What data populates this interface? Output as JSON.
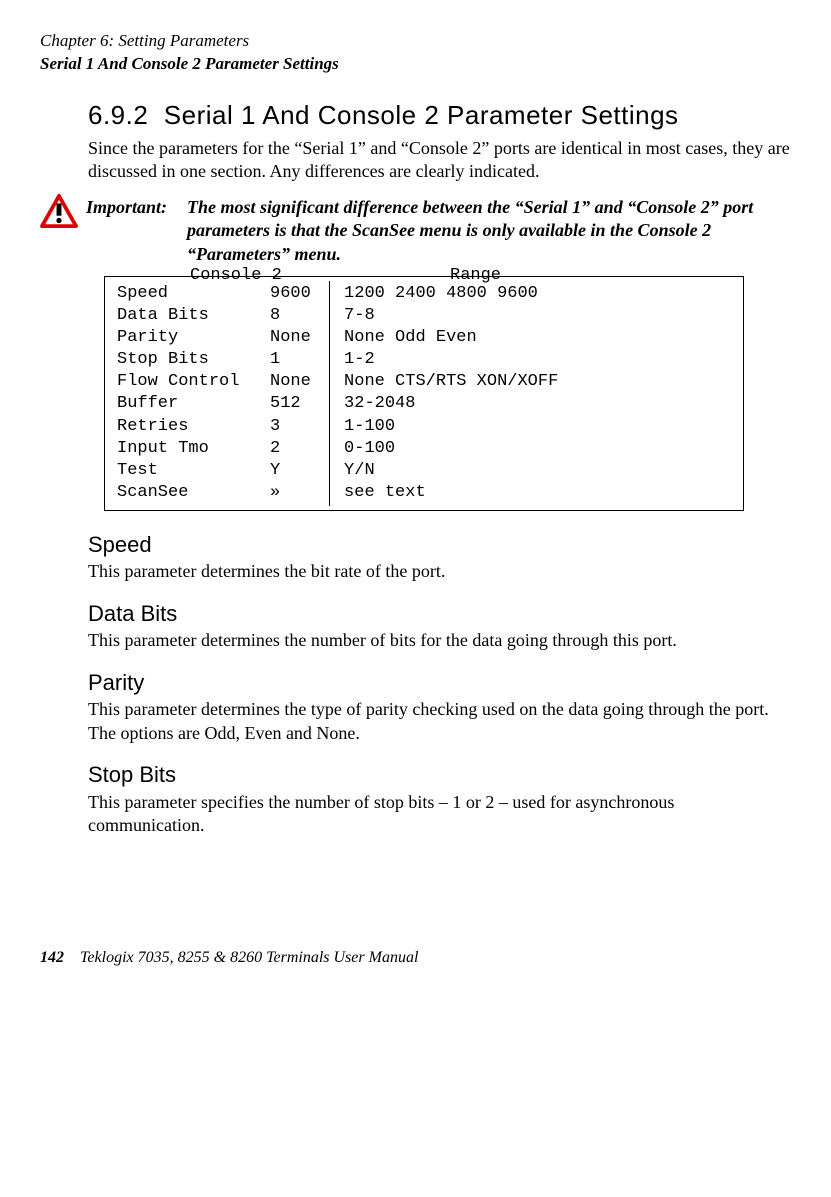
{
  "header": {
    "chapter": "Chapter 6: Setting Parameters",
    "subtitle": "Serial 1 And Console 2 Parameter Settings"
  },
  "section": {
    "number": "6.9.2",
    "title": "Serial 1 And Console 2 Parameter Settings",
    "intro": "Since the parameters for the “Serial 1” and “Console 2” ports are identical in most cases, they are discussed in one section. Any differences are clearly indicated."
  },
  "important": {
    "label": "Important:",
    "text": "The most significant difference between the “Serial 1” and “Con­sole 2” port parameters is that the ScanSee menu is only available in the Console 2 “Parameters” menu."
  },
  "table": {
    "legend_left": "Console 2",
    "legend_right": "Range",
    "rows": [
      {
        "name": "Speed",
        "value": "9600",
        "range": "1200 2400 4800 9600"
      },
      {
        "name": "Data Bits",
        "value": "8",
        "range": "7-8"
      },
      {
        "name": "Parity",
        "value": "None",
        "range": "None Odd Even"
      },
      {
        "name": "Stop Bits",
        "value": "1",
        "range": "1-2"
      },
      {
        "name": "Flow Control",
        "value": "None",
        "range": "None CTS/RTS XON/XOFF"
      },
      {
        "name": "Buffer",
        "value": "512",
        "range": "32-2048"
      },
      {
        "name": "Retries",
        "value": "3",
        "range": "1-100"
      },
      {
        "name": "Input Tmo",
        "value": "2",
        "range": "0-100"
      },
      {
        "name": "Test",
        "value": "Y",
        "range": "Y/N"
      },
      {
        "name": "ScanSee",
        "value": "»",
        "range": "see text"
      }
    ]
  },
  "subsections": [
    {
      "head": "Speed",
      "para": "This parameter determines the bit rate of the port."
    },
    {
      "head": "Data Bits",
      "para": "This parameter determines the number of bits for the data going through this port."
    },
    {
      "head": "Parity",
      "para": "This parameter determines the type of parity checking used on the data going through the port. The options are Odd, Even and None."
    },
    {
      "head": "Stop Bits",
      "para": "This parameter specifies the number of stop bits – 1 or 2 – used for asynchronous communication."
    }
  ],
  "footer": {
    "page": "142",
    "manual": "Teklogix 7035, 8255 & 8260 Terminals User Manual"
  }
}
